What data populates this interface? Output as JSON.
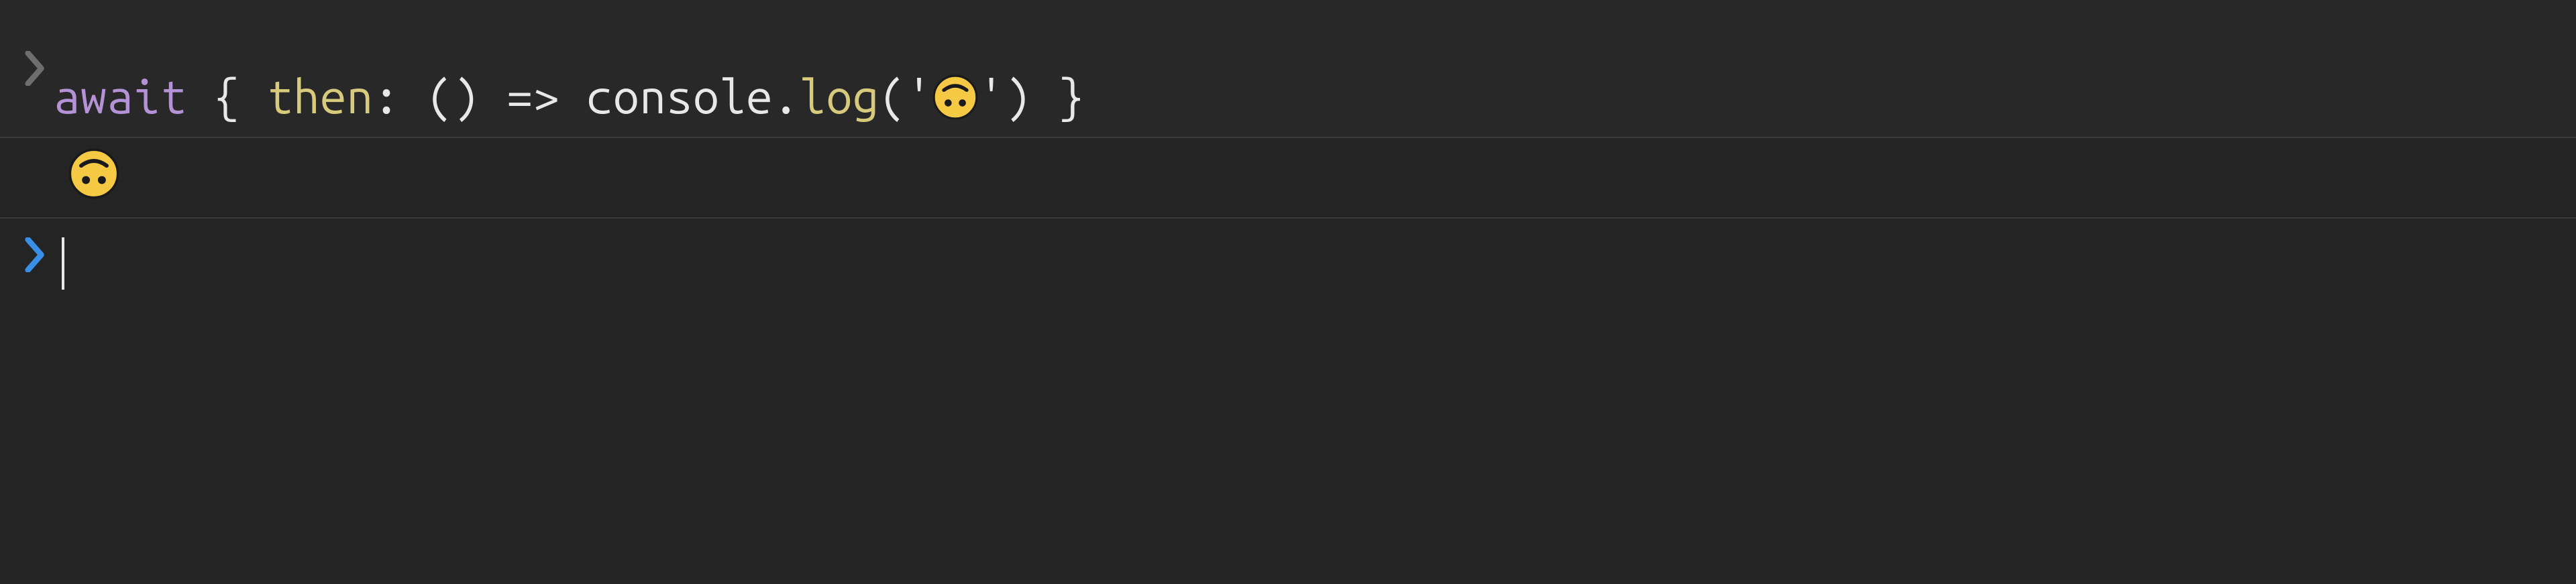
{
  "console": {
    "executed": {
      "tokens": {
        "await": "await",
        "space": " ",
        "open_brace": "{",
        "then": "then",
        "colon": ":",
        "paren_open": "(",
        "paren_close": ")",
        "arrow": "=>",
        "console_ident": "console",
        "dot": ".",
        "log": "log",
        "call_open": "(",
        "quote_open": "'",
        "emoji": "🙃",
        "quote_close": "'",
        "call_close": ")",
        "close_brace": "}"
      }
    },
    "output": {
      "emoji": "🙃"
    },
    "prompt": {
      "value": ""
    }
  },
  "icons": {
    "chevron_dim": "chevron-right",
    "chevron_active": "chevron-right"
  }
}
